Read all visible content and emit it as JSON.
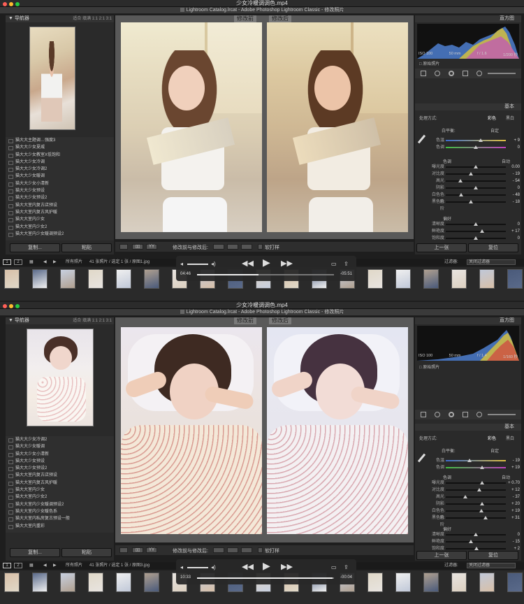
{
  "video_title": "少女冷暖调调色.mp4",
  "lr_title": "Lightroom Catalog.lrcat - Adobe Photoshop Lightroom Classic - 修改照片",
  "navigator": {
    "title": "导航器",
    "opts": "适合  填满  1:1  2:1  3:1"
  },
  "labels": {
    "before": "修改前",
    "after": "修改后",
    "histogram": "直方图",
    "basic": "基本",
    "copy": "复制...",
    "paste": "粘贴",
    "prev": "上一张",
    "reset": "复位",
    "before_after": "修改前与修改后:",
    "softproof": "软打样",
    "treatment": "处理方式:",
    "color": "彩色",
    "bw": "黑白",
    "wb": "白平衡:",
    "wb_value": "自定",
    "tone": "色调",
    "auto": "自动",
    "presence": "偏好",
    "raw": "原始照片",
    "filter": "过滤器:",
    "filter_value": "关闭过滤器",
    "all_photos": "所有照片"
  },
  "shots": [
    {
      "presets": [
        "猫大大主题调…强度3",
        "猫大大少女夏威",
        "猫大大少女教室X低饱和",
        "猫大大少女冷调",
        "猫大大少女冷调2",
        "猫大大少女暖调",
        "猫大大少女小清新",
        "猫大大少女预设",
        "猫大大少女预设2",
        "猫大大室内复古店预设",
        "猫大大室内复古风护暖",
        "猫大大室内少女",
        "猫大大室内少女2",
        "猫大大室内少女暖调预设2"
      ],
      "status": "41 张照片 / 选定 1 张 / 原图1.jpg",
      "hist_info": [
        "ISO 100",
        "50 mm",
        "f / 1.6",
        "1/200 秒"
      ],
      "wb_sliders": [
        [
          "色温",
          "+ 9",
          0.58
        ],
        [
          "色调",
          "0",
          0.5
        ]
      ],
      "tone_sliders": [
        [
          "曝光度",
          "0.00",
          0.5
        ],
        [
          "对比度",
          "- 19",
          0.42
        ],
        [
          "高光",
          "- 54",
          0.24
        ],
        [
          "阴影",
          "0",
          0.5
        ],
        [
          "白色色阶",
          "- 48",
          0.26
        ],
        [
          "黑色色阶",
          "- 18",
          0.42
        ]
      ],
      "presence_sliders": [
        [
          "清晰度",
          "0",
          0.5
        ],
        [
          "鲜艳度",
          "+ 17",
          0.6
        ],
        [
          "饱和度",
          "0",
          0.5
        ]
      ],
      "time_now": "04:46",
      "time_left": "-05:51",
      "progress": 0.45
    },
    {
      "presets": [
        "猫大大少女冷调2",
        "猫大大少女暖调",
        "猫大大少女小清新",
        "猫大大少女预设",
        "猫大大少女预设2",
        "猫大大室内复古店预设",
        "猫大大室内复古风护暖",
        "猫大大室内少女",
        "猫大大室内少女2",
        "猫大大室内少女暖调预设2",
        "猫大大室内少女暖色系",
        "猫大大室内私房复古预设一般",
        "猫大大室内重彩"
      ],
      "status": "41 张照片 / 选定 1 张 / 原图3.jpg",
      "hist_info": [
        "ISO 100",
        "50 mm",
        "f / 1.4",
        "1/160 秒"
      ],
      "wb_sliders": [
        [
          "色温",
          "- 19",
          0.4
        ],
        [
          "色调",
          "+ 19",
          0.6
        ]
      ],
      "tone_sliders": [
        [
          "曝光度",
          "+ 0.70",
          0.6
        ],
        [
          "对比度",
          "+ 12",
          0.56
        ],
        [
          "高光",
          "- 37",
          0.32
        ],
        [
          "阴影",
          "+ 20",
          0.6
        ],
        [
          "白色色阶",
          "+ 19",
          0.59
        ],
        [
          "黑色色阶",
          "+ 31",
          0.66
        ]
      ],
      "presence_sliders": [
        [
          "清晰度",
          "0",
          0.5
        ],
        [
          "鲜艳度",
          "- 15",
          0.42
        ],
        [
          "饱和度",
          "+ 2",
          0.51
        ]
      ],
      "time_now": "10:33",
      "time_left": "-00:04",
      "progress": 0.99
    }
  ],
  "colors": {
    "bg": "#1e1e1e",
    "panel": "#2a2a2a",
    "accent": "#6aa0ff"
  }
}
